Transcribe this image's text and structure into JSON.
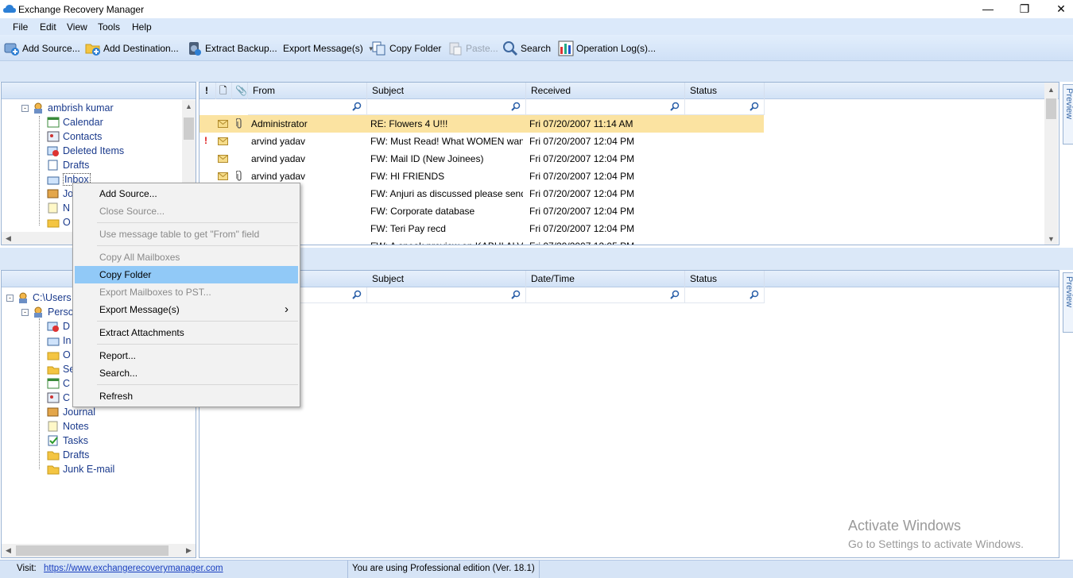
{
  "window": {
    "title": "Exchange Recovery Manager",
    "minimize": "—",
    "maximize": "❐",
    "close": "✕"
  },
  "menu": [
    "File",
    "Edit",
    "View",
    "Tools",
    "Help"
  ],
  "toolbar": {
    "add_source": "Add Source...",
    "add_destination": "Add Destination...",
    "extract_backup": "Extract Backup...",
    "export_messages": "Export Message(s)",
    "copy_folder": "Copy Folder",
    "paste": "Paste...",
    "search": "Search",
    "operation_logs": "Operation Log(s)..."
  },
  "source_tree": {
    "root": "ambrish kumar",
    "items": [
      "Calendar",
      "Contacts",
      "Deleted Items",
      "Drafts",
      "Inbox",
      "Jo",
      "N",
      "O"
    ]
  },
  "dest_tree": {
    "root": "C:\\Users",
    "pst": "Perso",
    "items": [
      "D",
      "In",
      "O",
      "Se",
      "C",
      "C",
      "Journal",
      "Notes",
      "Tasks",
      "Drafts",
      "Junk E-mail"
    ]
  },
  "message_table": {
    "columns": {
      "importance": "!",
      "type": "🗋",
      "attach": "📎",
      "from": "From",
      "subject": "Subject",
      "received": "Received",
      "status": "Status"
    },
    "rows": [
      {
        "from": "Administrator",
        "subject": "RE: Flowers 4 U!!!",
        "received": "Fri 07/20/2007 11:14 AM",
        "important": false,
        "attach": true
      },
      {
        "from": "arvind yadav",
        "subject": "FW: Must Read! What WOMEN want?",
        "received": "Fri 07/20/2007 12:04 PM",
        "important": true,
        "attach": false
      },
      {
        "from": "arvind yadav",
        "subject": "FW: Mail ID (New Joinees)",
        "received": "Fri 07/20/2007 12:04 PM",
        "important": false,
        "attach": false
      },
      {
        "from": "arvind yadav",
        "subject": "FW: HI FRIENDS",
        "received": "Fri 07/20/2007 12:04 PM",
        "important": false,
        "attach": true
      },
      {
        "from": "",
        "subject": "FW: Anjuri as discussed please send t...",
        "received": "Fri 07/20/2007 12:04 PM",
        "important": false,
        "attach": false
      },
      {
        "from": "",
        "subject": "FW: Corporate database",
        "received": "Fri 07/20/2007 12:04 PM",
        "important": false,
        "attach": false
      },
      {
        "from": "",
        "subject": "FW: Teri Pay recd",
        "received": "Fri 07/20/2007 12:04 PM",
        "important": false,
        "attach": false
      },
      {
        "from": "",
        "subject": "FW: A sneak preview on KABHI ALVI...",
        "received": "Fri 07/20/2007 12:05 PM",
        "important": false,
        "attach": false
      }
    ]
  },
  "dest_table": {
    "columns": {
      "subject": "Subject",
      "datetime": "Date/Time",
      "status": "Status"
    }
  },
  "preview_tab": "Preview",
  "context_menu": {
    "add_source": "Add Source...",
    "close_source": "Close Source...",
    "use_table": "Use message table to get \"From\" field",
    "copy_all": "Copy All Mailboxes",
    "copy_folder": "Copy Folder",
    "export_pst": "Export Mailboxes to PST...",
    "export_messages": "Export Message(s)",
    "extract_attachments": "Extract Attachments",
    "report": "Report...",
    "search": "Search...",
    "refresh": "Refresh",
    "submenu_arrow": "›"
  },
  "status": {
    "visit_label": "Visit:",
    "url": "https://www.exchangerecoverymanager.com",
    "edition": "You are using Professional edition (Ver. 18.1)"
  },
  "watermark": {
    "title": "Activate Windows",
    "subtitle": "Go to Settings to activate Windows."
  },
  "colors": {
    "accent": "#1a3a8c",
    "selected_row": "#fbe3a1",
    "menu_highlight": "#91c9f7"
  }
}
